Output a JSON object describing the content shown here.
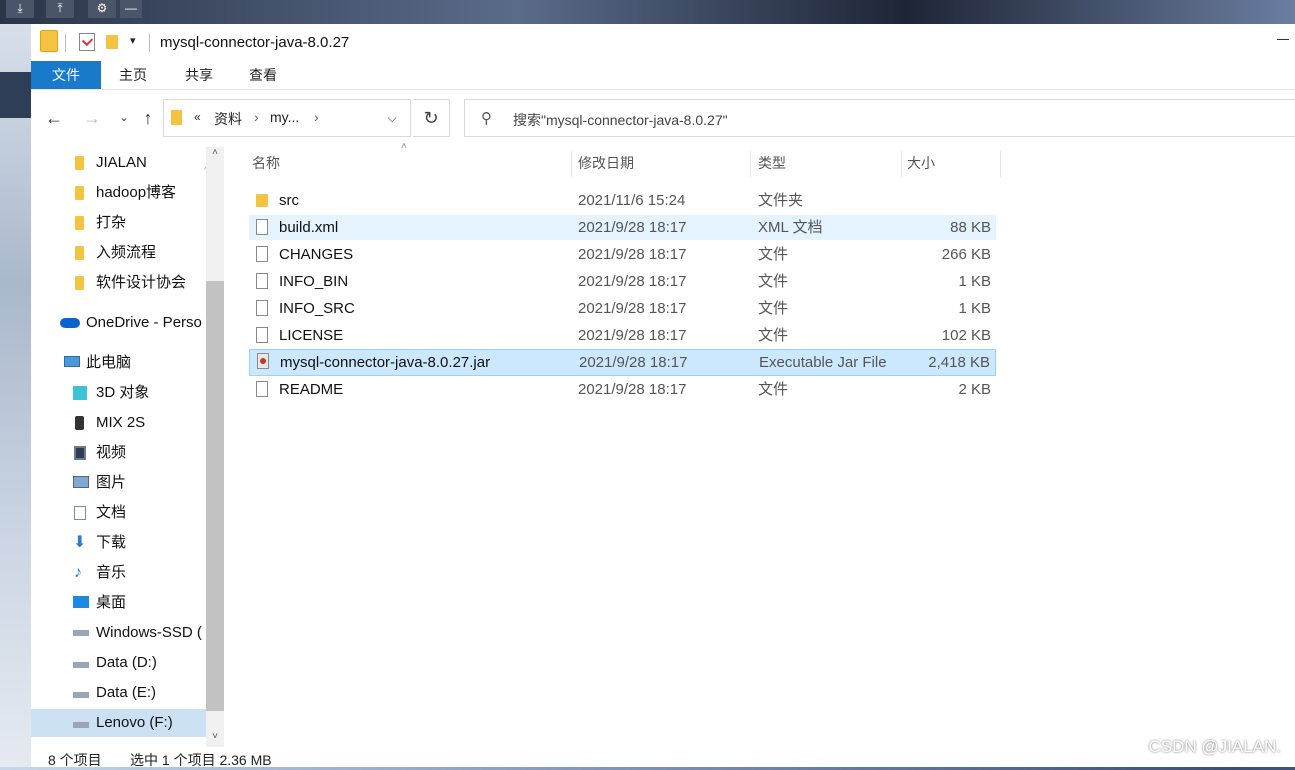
{
  "window": {
    "title": "mysql-connector-java-8.0.27",
    "quick_access_dropdown": "▾"
  },
  "ribbon": {
    "tabs": [
      {
        "label": "文件"
      },
      {
        "label": "主页"
      },
      {
        "label": "共享"
      },
      {
        "label": "查看"
      }
    ]
  },
  "address_bar": {
    "overflow": "«",
    "crumbs": [
      "资料",
      "my..."
    ],
    "search_placeholder": "搜索\"mysql-connector-java-8.0.27\""
  },
  "nav_pane": {
    "items": [
      {
        "label": "JIALAN",
        "icon": "folder-icon",
        "pinned": true
      },
      {
        "label": "hadoop博客",
        "icon": "folder-icon"
      },
      {
        "label": "打杂",
        "icon": "folder-icon"
      },
      {
        "label": "入频流程",
        "icon": "folder-icon"
      },
      {
        "label": "软件设计协会",
        "icon": "folder-icon"
      },
      {
        "label": "OneDrive - Perso",
        "icon": "onedrive-icon"
      },
      {
        "label": "此电脑",
        "icon": "this-pc-icon"
      },
      {
        "label": "3D 对象",
        "icon": "3d-objects-icon"
      },
      {
        "label": "MIX 2S",
        "icon": "phone-icon"
      },
      {
        "label": "视频",
        "icon": "video-icon"
      },
      {
        "label": "图片",
        "icon": "pictures-icon"
      },
      {
        "label": "文档",
        "icon": "documents-icon"
      },
      {
        "label": "下载",
        "icon": "download-icon"
      },
      {
        "label": "音乐",
        "icon": "music-icon"
      },
      {
        "label": "桌面",
        "icon": "desktop-icon"
      },
      {
        "label": "Windows-SSD (",
        "icon": "drive-icon"
      },
      {
        "label": "Data (D:)",
        "icon": "drive-icon"
      },
      {
        "label": "Data (E:)",
        "icon": "drive-icon"
      },
      {
        "label": "Lenovo (F:)",
        "icon": "drive-icon",
        "selected": true
      }
    ]
  },
  "file_list": {
    "headers": {
      "name": "名称",
      "date": "修改日期",
      "type": "类型",
      "size": "大小"
    },
    "rows": [
      {
        "name": "src",
        "date": "2021/11/6 15:24",
        "type": "文件夹",
        "size": "",
        "icon": "folder-icon"
      },
      {
        "name": "build.xml",
        "date": "2021/9/28 18:17",
        "type": "XML 文档",
        "size": "88 KB",
        "icon": "file-icon"
      },
      {
        "name": "CHANGES",
        "date": "2021/9/28 18:17",
        "type": "文件",
        "size": "266 KB",
        "icon": "file-icon"
      },
      {
        "name": "INFO_BIN",
        "date": "2021/9/28 18:17",
        "type": "文件",
        "size": "1 KB",
        "icon": "file-icon"
      },
      {
        "name": "INFO_SRC",
        "date": "2021/9/28 18:17",
        "type": "文件",
        "size": "1 KB",
        "icon": "file-icon"
      },
      {
        "name": "LICENSE",
        "date": "2021/9/28 18:17",
        "type": "文件",
        "size": "102 KB",
        "icon": "file-icon"
      },
      {
        "name": "mysql-connector-java-8.0.27.jar",
        "date": "2021/9/28 18:17",
        "type": "Executable Jar File",
        "size": "2,418 KB",
        "icon": "jar-icon"
      },
      {
        "name": "README",
        "date": "2021/9/28 18:17",
        "type": "文件",
        "size": "2 KB",
        "icon": "file-icon"
      }
    ]
  },
  "status_bar": {
    "item_count": "8 个项目",
    "selection": "选中 1 个项目  2.36 MB"
  },
  "watermark": "CSDN @JIALAN.",
  "colors": {
    "accent": "#1979ca",
    "selection": "#cce8ff",
    "hover": "#e5f3ff",
    "folder": "#f5c342"
  }
}
